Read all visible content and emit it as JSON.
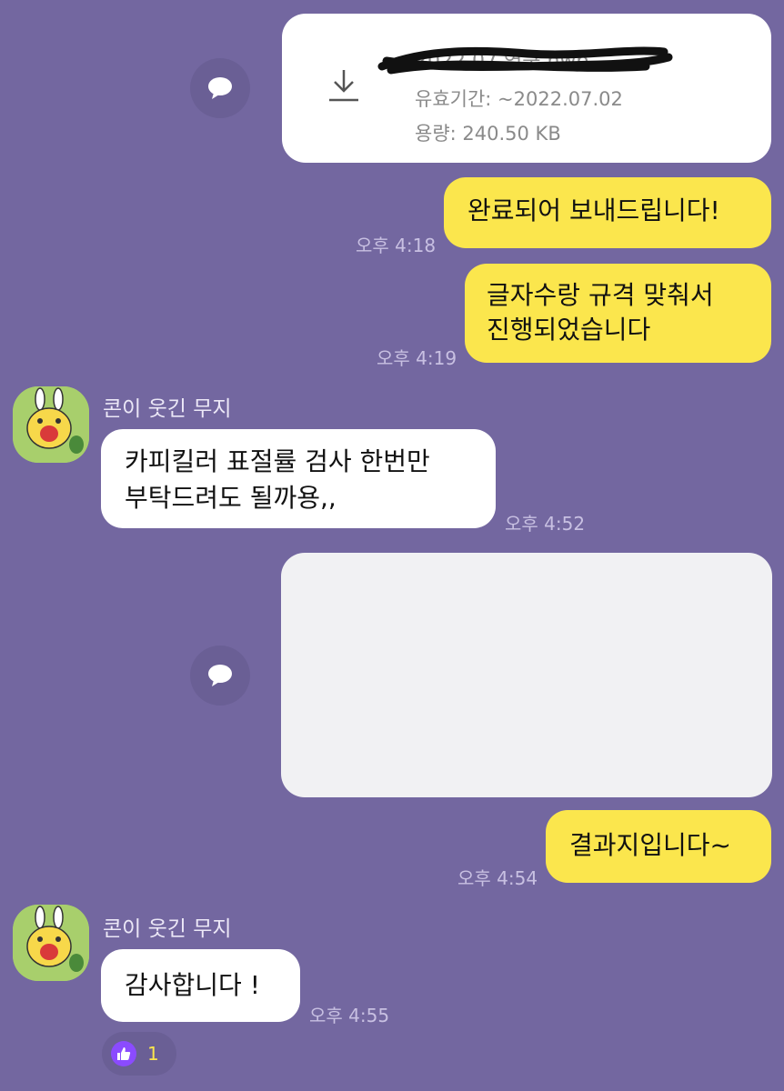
{
  "file_message": {
    "filename": "2022.07 연구.hwp",
    "expiry": "유효기간: ~2022.07.02",
    "size": "용량: 240.50 KB"
  },
  "messages": [
    {
      "from": "me",
      "text": "완료되어 보내드립니다!",
      "time": "오후 4:18"
    },
    {
      "from": "me",
      "lines": [
        "글자수랑 규격 맞춰서",
        "진행되었습니다"
      ],
      "time": "오후 4:19"
    },
    {
      "from": "other",
      "sender": "콘이 웃긴 무지",
      "lines": [
        "카피킬러 표절률 검사 한번만",
        "부탁드려도 될까용,,"
      ],
      "time": "오후 4:52"
    },
    {
      "from": "me",
      "text": "결과지입니다~",
      "time": "오후 4:54"
    },
    {
      "from": "other",
      "sender": "콘이 웃긴 무지",
      "text": "감사합니다 !",
      "time": "오후 4:55"
    }
  ],
  "reaction": {
    "icon": "thumbs-up-icon",
    "count": "1"
  },
  "colors": {
    "background": "#7367a0",
    "my_bubble": "#fbe64d",
    "other_bubble": "#ffffff",
    "reaction_accent": "#8b4bff"
  }
}
